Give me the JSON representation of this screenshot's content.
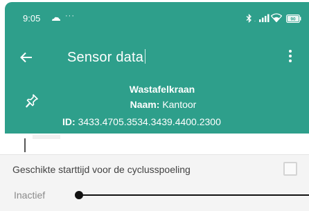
{
  "status_bar": {
    "time": "9:05",
    "dots": "···",
    "battery_level": "90"
  },
  "app_bar": {
    "title": "Sensor data"
  },
  "device": {
    "name": "Wastafelkraan",
    "naam_label": "Naam:",
    "naam_value": "Kantoor",
    "id_label": "ID:",
    "id_value": "3433.4705.3534.3439.4400.2300"
  },
  "setting": {
    "title": "Geschikte starttijd voor de cyclusspoeling",
    "value": "Inactief",
    "checked": false
  },
  "colors": {
    "primary": "#2e9f8b",
    "sheet_background": "#f4f4f4"
  }
}
